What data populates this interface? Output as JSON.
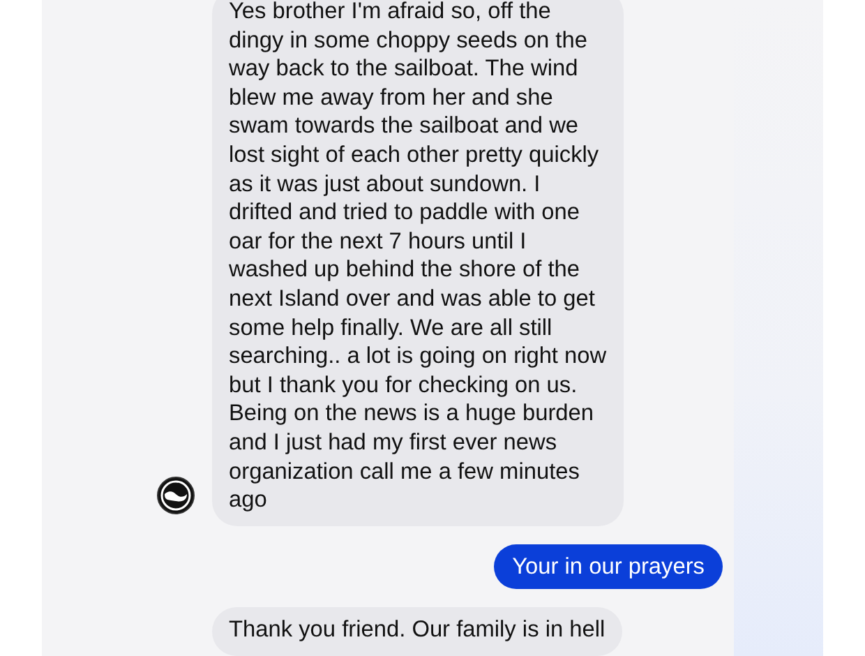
{
  "messages": [
    {
      "kind": "incoming",
      "avatar": true,
      "lines": [
        "Yes brother I'm afraid so, off the",
        "dingy in some choppy seeds on the",
        "way back to the sailboat. The wind",
        "blew me away from her and she",
        "swam towards the sailboat and we",
        "lost sight of each other pretty quickly",
        "as it was just about sundown. I",
        "drifted and tried to paddle with one",
        "oar for the next 7 hours until I",
        "washed up behind the shore of the",
        "next Island over and was able to get",
        "some help finally. We are all still",
        "searching.. a lot is going on right now",
        "but I thank you for checking on us.",
        "Being on the news is a huge burden",
        "and I just had my first ever news",
        "organization call me a few minutes",
        "ago"
      ]
    },
    {
      "kind": "outgoing",
      "lines": [
        "Your in our prayers"
      ]
    },
    {
      "kind": "incoming",
      "avatar": false,
      "lines": [
        "Thank you friend. Our family is in hell"
      ]
    }
  ]
}
